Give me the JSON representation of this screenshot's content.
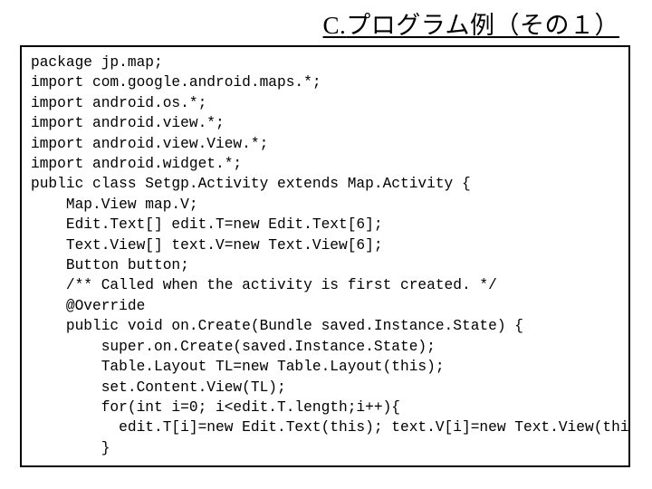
{
  "title_c": "C.",
  "title_rest": "プログラム例（その１）",
  "code_lines": [
    "package jp.map;",
    "import com.google.android.maps.*;",
    "import android.os.*;",
    "import android.view.*;",
    "import android.view.View.*;",
    "import android.widget.*;",
    "public class Setgp.Activity extends Map.Activity {",
    "    Map.View map.V;",
    "    Edit.Text[] edit.T=new Edit.Text[6];",
    "    Text.View[] text.V=new Text.View[6];",
    "    Button button;",
    "    /** Called when the activity is first created. */",
    "    @Override",
    "    public void on.Create(Bundle saved.Instance.State) {",
    "        super.on.Create(saved.Instance.State);",
    "        Table.Layout TL=new Table.Layout(this);",
    "        set.Content.View(TL);",
    "        for(int i=0; i<edit.T.length;i++){",
    "          edit.T[i]=new Edit.Text(this); text.V[i]=new Text.View(this);",
    "        }"
  ]
}
